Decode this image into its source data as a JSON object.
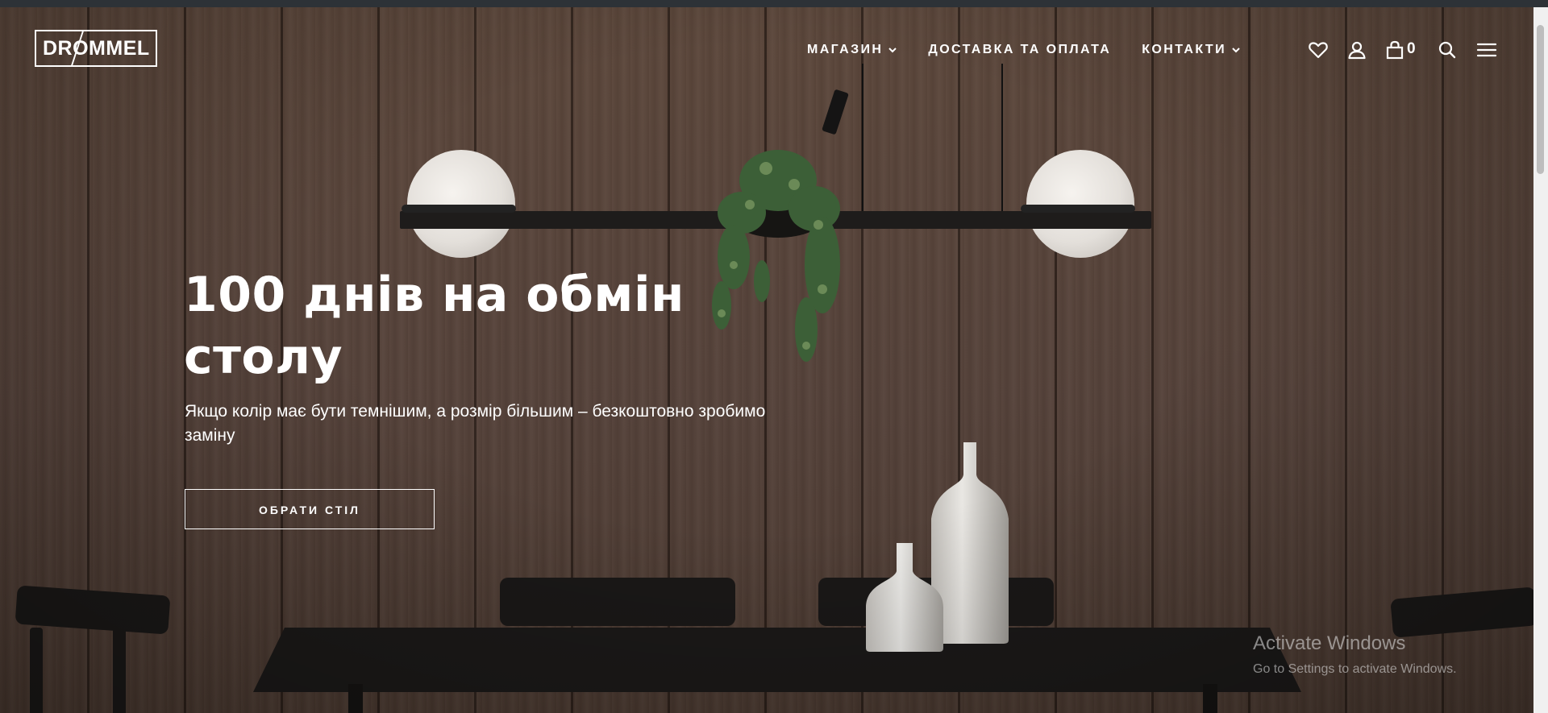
{
  "brand": {
    "logo_text": "DROMMEL"
  },
  "nav": {
    "items": [
      {
        "label": "МАГАЗИН",
        "has_dropdown": true
      },
      {
        "label": "ДОСТАВКА ТА ОПЛАТА",
        "has_dropdown": false
      },
      {
        "label": "КОНТАКТИ",
        "has_dropdown": true
      }
    ]
  },
  "header_icons": {
    "wishlist": "heart-icon",
    "account": "user-icon",
    "cart": "shopping-bag-icon",
    "cart_count": "0",
    "search": "search-icon",
    "menu": "hamburger-menu-icon"
  },
  "hero": {
    "title": "100 днів на обмін столу",
    "subtitle": "Якщо колір має бути темнішим, а розмір більшим – безкоштовно зробимо заміну",
    "cta_label": "ОБРАТИ СТІЛ"
  },
  "overlay": {
    "watermark_title": "Activate Windows",
    "watermark_sub": "Go to Settings to activate Windows."
  },
  "colors": {
    "text": "#ffffff",
    "wood": "#5c473b",
    "top_strip": "#2d3237"
  }
}
